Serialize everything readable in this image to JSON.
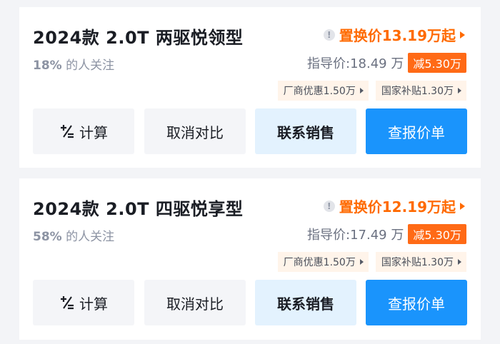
{
  "cards": [
    {
      "title": "2024款 2.0T 两驱悦领型",
      "follow_pct": "18%",
      "follow_suffix": "的人关注",
      "trade_price": "置换价13.19万起",
      "guide_price": "指导价:18.49 万",
      "reduce_badge": "减5.30万",
      "promos": [
        "厂商优惠1.50万",
        "国家补贴1.30万"
      ],
      "buttons": {
        "calc": "计算",
        "compare": "取消对比",
        "contact": "联系销售",
        "price": "查报价单"
      }
    },
    {
      "title": "2024款 2.0T 四驱悦享型",
      "follow_pct": "58%",
      "follow_suffix": "的人关注",
      "trade_price": "置换价12.19万起",
      "guide_price": "指导价:17.49 万",
      "reduce_badge": "减5.30万",
      "promos": [
        "厂商优惠1.50万",
        "国家补贴1.30万"
      ],
      "buttons": {
        "calc": "计算",
        "compare": "取消对比",
        "contact": "联系销售",
        "price": "查报价单"
      }
    }
  ],
  "icons": {
    "info": "info-icon",
    "arrow": "chevron-right-icon",
    "calc": "calculator-plus-minus-icon"
  },
  "colors": {
    "accent_orange": "#ff6a00",
    "badge_orange": "#ff6a16",
    "primary_blue": "#1a94fc",
    "contact_bg": "#e3f2fe"
  }
}
